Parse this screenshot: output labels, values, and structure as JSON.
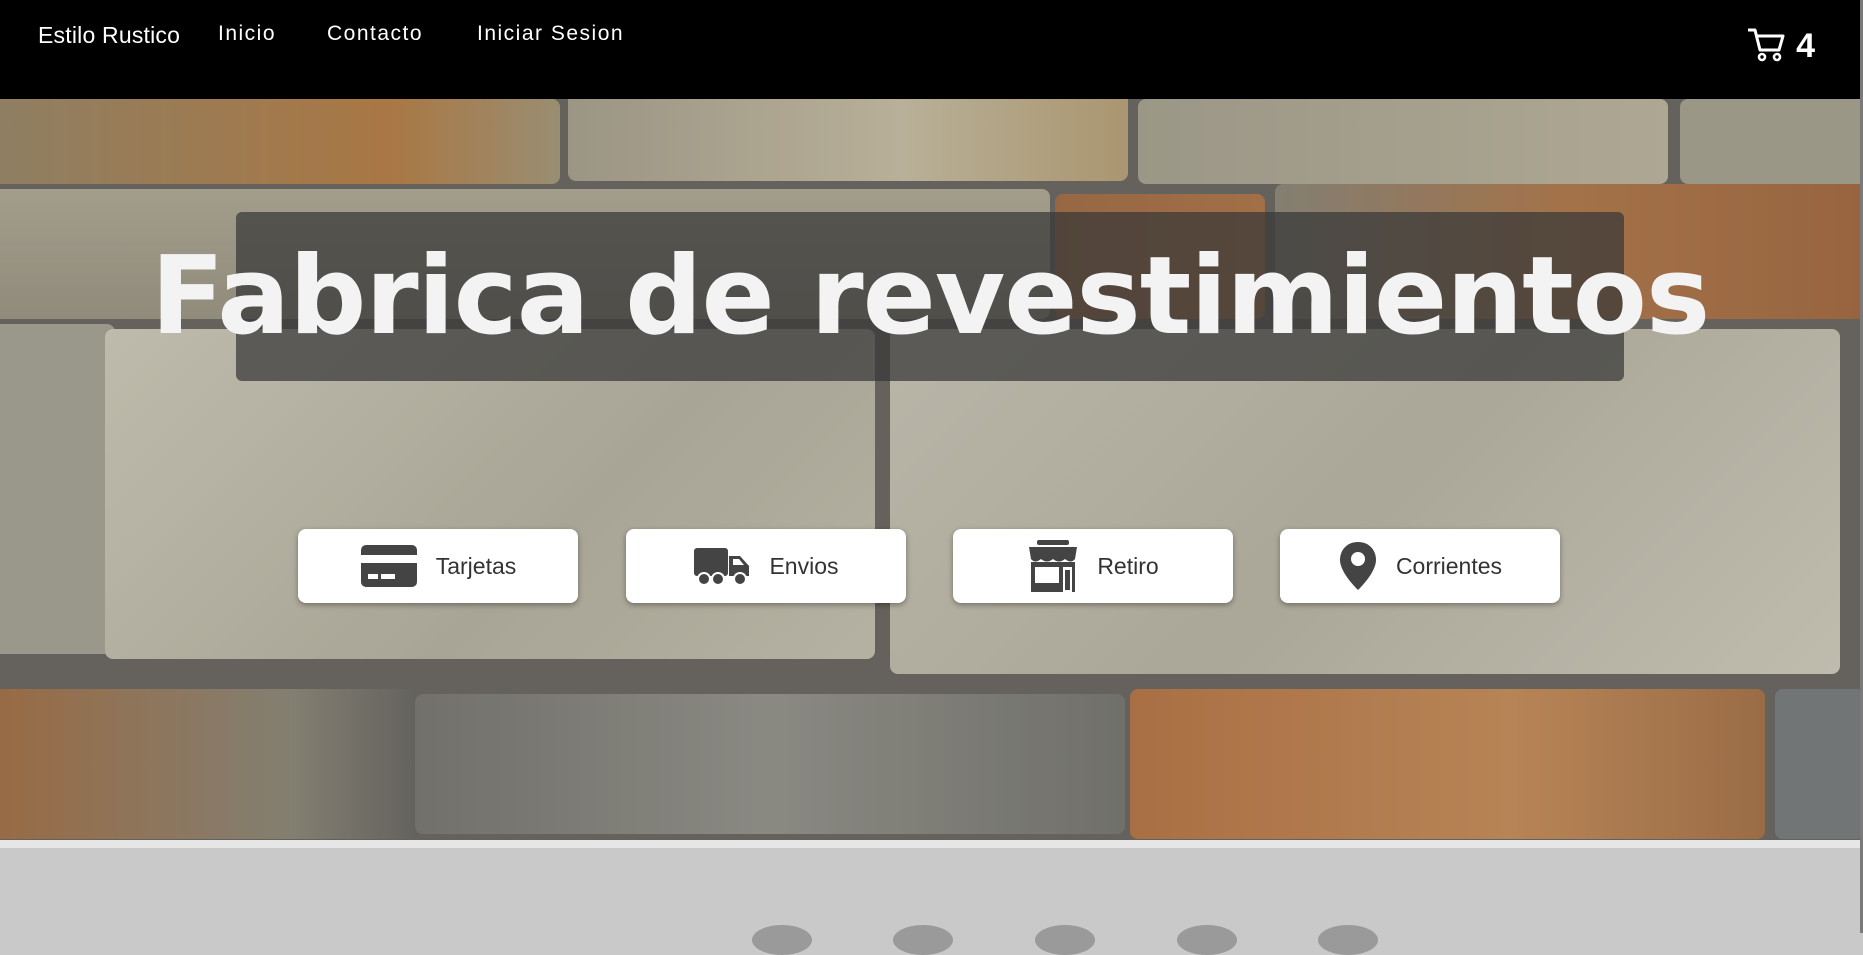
{
  "navbar": {
    "brand": "Estilo Rustico",
    "links": [
      {
        "label": "Inicio"
      },
      {
        "label": "Contacto"
      },
      {
        "label": "Iniciar Sesion"
      }
    ],
    "cart": {
      "icon": "shopping-cart-icon",
      "count": "4"
    }
  },
  "hero": {
    "title": "Fabrica de revestimientos",
    "features": [
      {
        "label": "Tarjetas",
        "icon": "credit-card-icon"
      },
      {
        "label": "Envios",
        "icon": "truck-icon"
      },
      {
        "label": "Retiro",
        "icon": "store-icon"
      },
      {
        "label": "Corrientes",
        "icon": "map-pin-icon"
      }
    ]
  },
  "colors": {
    "navbar_bg": "#000000",
    "title_box": "#373737",
    "button_bg": "#ffffff",
    "icon": "#444444"
  }
}
